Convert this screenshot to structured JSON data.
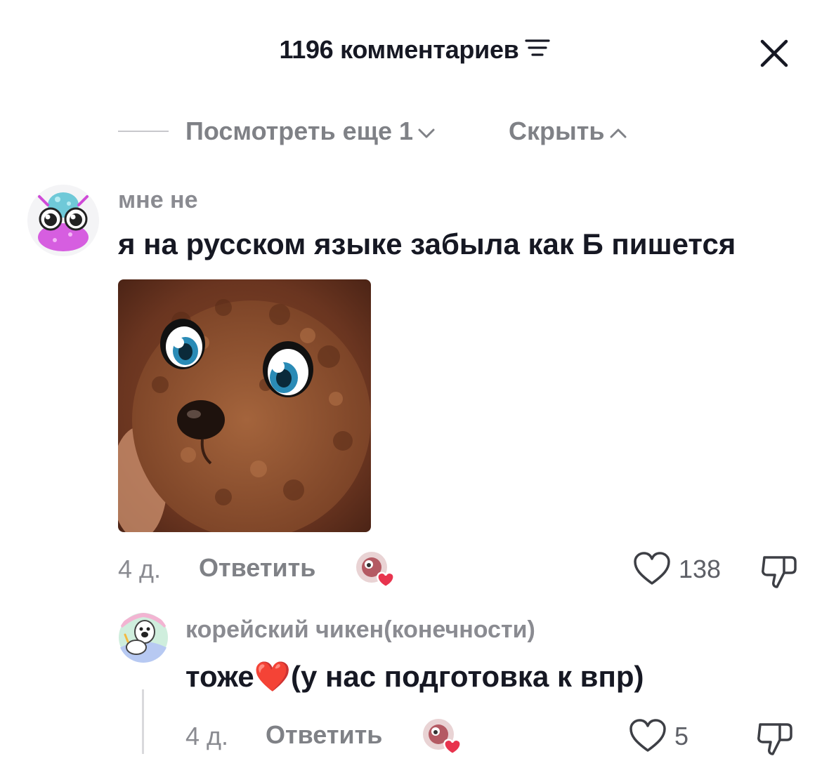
{
  "header": {
    "title": "1196 комментариев",
    "filter_icon": "filter-lines-icon",
    "close_icon": "close-icon"
  },
  "thread": {
    "view_more": "Посмотреть еще 1",
    "hide": "Скрыть"
  },
  "comments": [
    {
      "author": "мне не",
      "text": "я на русском языке забыла как Б пишется",
      "time": "4 д.",
      "reply_label": "Ответить",
      "likes": "138"
    },
    {
      "author": "корейский чикен(конечности)",
      "text": "тоже❤️(у нас подготовка к впр)",
      "time": "4 д.",
      "reply_label": "Ответить",
      "likes": "5"
    }
  ],
  "colors": {
    "text": "#161823",
    "secondary": "#8a8b91",
    "heart": "#e8344e"
  }
}
